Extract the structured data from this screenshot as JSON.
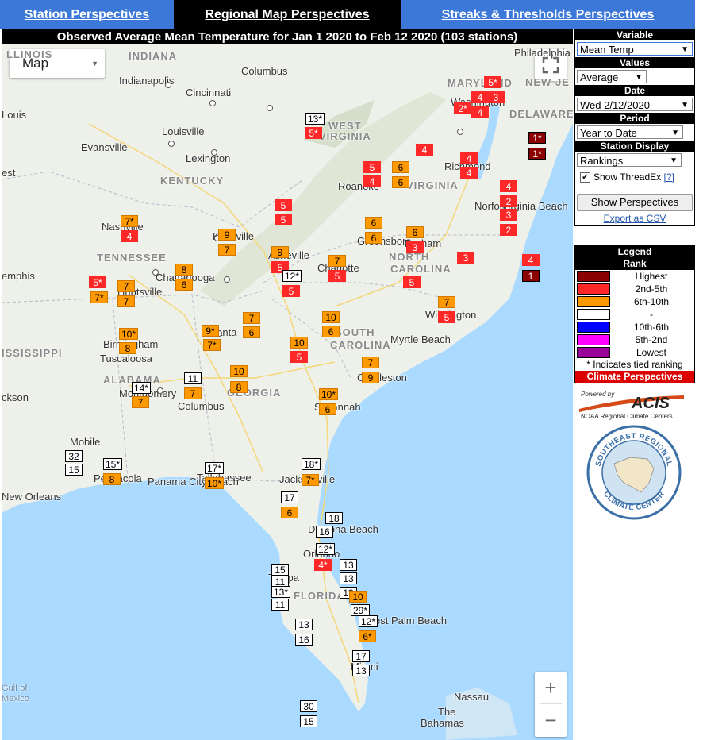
{
  "tabs": [
    "Station Perspectives",
    "Regional Map Perspectives",
    "Streaks & Thresholds Perspectives"
  ],
  "title": "Observed Average Mean Temperature for Jan 1 2020 to Feb 12 2020 (103 stations)",
  "map_type": "Map",
  "zoom": {
    "in": "+",
    "out": "−"
  },
  "controls": {
    "variable_label": "Variable",
    "variable": "Mean Temp",
    "values_label": "Values",
    "values": "Average",
    "date_label": "Date",
    "date": "Wed 2/12/2020",
    "period_label": "Period",
    "period": "Year to Date",
    "display_label": "Station Display",
    "display": "Rankings",
    "threadex_label": "Show ThreadEx",
    "threadex_help": "[?]",
    "threadex_checked": true,
    "show_button": "Show Perspectives",
    "export_link": "Export as CSV"
  },
  "legend": {
    "title": "Legend",
    "subtitle": "Rank",
    "items": [
      {
        "label": "Highest",
        "color": "#8b0000"
      },
      {
        "label": "2nd-5th",
        "color": "#ff2828"
      },
      {
        "label": "6th-10th",
        "color": "#ff9900"
      },
      {
        "label": "-",
        "color": "#ffffff"
      },
      {
        "label": "10th-6th",
        "color": "#0000ff"
      },
      {
        "label": "5th-2nd",
        "color": "#ff00ff"
      },
      {
        "label": "Lowest",
        "color": "#990099"
      }
    ],
    "note": "* Indicates tied ranking",
    "footer": "Climate Perspectives"
  },
  "acis": {
    "powered_by": "Powered by",
    "name": "ACIS",
    "sub": "NOAA Regional Climate Centers"
  },
  "seal": {
    "top": "SOUTHEAST REGIONAL",
    "bottom": "CLIMATE CENTER"
  },
  "map_labels": {
    "states": [
      {
        "text": "INDIANA"
      },
      {
        "text": "KENTUCKY"
      },
      {
        "text": "TENNESSEE"
      },
      {
        "text": "WEST"
      },
      {
        "text": "VIRGINIA"
      },
      {
        "text": "VIRGINIA"
      },
      {
        "text": "NORTH"
      },
      {
        "text": "CAROLINA"
      },
      {
        "text": "SOUTH"
      },
      {
        "text": "CAROLINA"
      },
      {
        "text": "GEORGIA"
      },
      {
        "text": "ALABAMA"
      },
      {
        "text": "ISSISSIPPI"
      },
      {
        "text": "FLORIDA"
      },
      {
        "text": "MARYLAND"
      },
      {
        "text": "DELAWARE"
      },
      {
        "text": "NEW JE"
      },
      {
        "text": "LLINOIS"
      }
    ],
    "cities": [
      "Columbus",
      "Indianapolis",
      "Cincinnati",
      "Louisville",
      "Lexington",
      "Evansville",
      "Louis",
      "est",
      "Nashville",
      "Chattanooga",
      "Knoxville",
      "Asheville",
      "Huntsville",
      "Birmingham",
      "Tuscaloosa",
      "Atlanta",
      "Montgomery",
      "Columbus",
      "Mobile",
      "Pensacola",
      "Tallahassee",
      "Jacksonville",
      "Savannah",
      "Charleston",
      "Myrtle Beach",
      "Wilmington",
      "Charlotte",
      "Greensboro",
      "Durham",
      "Roanoke",
      "Richmond",
      "Washington",
      "Norfolk",
      "Virginia Beach",
      "Philadelphia",
      "Daytona Beach",
      "Orlando",
      "Tampa",
      "West Palm Beach",
      "Miami",
      "Nassau",
      "The",
      "Bahamas",
      "New Orleans",
      "Panama City Beach",
      "Gulf of",
      "Mexico",
      "emphis",
      "ckson"
    ]
  },
  "markers": [
    {
      "v": "5*",
      "r": "top5"
    },
    {
      "v": "4",
      "r": "top5"
    },
    {
      "v": "3",
      "r": "top5"
    },
    {
      "v": "2*",
      "r": "top5"
    },
    {
      "v": "4",
      "r": "top5"
    },
    {
      "v": "13*",
      "r": "none"
    },
    {
      "v": "5*",
      "r": "top5"
    },
    {
      "v": "1*",
      "r": "high"
    },
    {
      "v": "1*",
      "r": "high"
    },
    {
      "v": "4",
      "r": "top5"
    },
    {
      "v": "4",
      "r": "top5"
    },
    {
      "v": "4",
      "r": "top5"
    },
    {
      "v": "5",
      "r": "top5"
    },
    {
      "v": "4",
      "r": "top5"
    },
    {
      "v": "6",
      "r": "top10"
    },
    {
      "v": "6",
      "r": "top10"
    },
    {
      "v": "4",
      "r": "top5"
    },
    {
      "v": "2",
      "r": "top5"
    },
    {
      "v": "3",
      "r": "top5"
    },
    {
      "v": "2",
      "r": "top5"
    },
    {
      "v": "5",
      "r": "top5"
    },
    {
      "v": "5",
      "r": "top5"
    },
    {
      "v": "7*",
      "r": "top10"
    },
    {
      "v": "4",
      "r": "top5"
    },
    {
      "v": "9",
      "r": "top10"
    },
    {
      "v": "7",
      "r": "top10"
    },
    {
      "v": "6",
      "r": "top10"
    },
    {
      "v": "6",
      "r": "top10"
    },
    {
      "v": "6",
      "r": "top10"
    },
    {
      "v": "3",
      "r": "top5"
    },
    {
      "v": "3",
      "r": "top5"
    },
    {
      "v": "4",
      "r": "top5"
    },
    {
      "v": "1",
      "r": "high"
    },
    {
      "v": "8",
      "r": "top10"
    },
    {
      "v": "6",
      "r": "top10"
    },
    {
      "v": "9",
      "r": "top10"
    },
    {
      "v": "5",
      "r": "top5"
    },
    {
      "v": "12*",
      "r": "none"
    },
    {
      "v": "7",
      "r": "top10"
    },
    {
      "v": "5",
      "r": "top5"
    },
    {
      "v": "5",
      "r": "top5"
    },
    {
      "v": "5",
      "r": "top5"
    },
    {
      "v": "5*",
      "r": "top5"
    },
    {
      "v": "7*",
      "r": "top10"
    },
    {
      "v": "7",
      "r": "top10"
    },
    {
      "v": "7",
      "r": "top10"
    },
    {
      "v": "7",
      "r": "top10"
    },
    {
      "v": "6",
      "r": "top10"
    },
    {
      "v": "10*",
      "r": "top10"
    },
    {
      "v": "8",
      "r": "top10"
    },
    {
      "v": "9*",
      "r": "top10"
    },
    {
      "v": "7*",
      "r": "top10"
    },
    {
      "v": "7",
      "r": "top10"
    },
    {
      "v": "5",
      "r": "top5"
    },
    {
      "v": "10",
      "r": "top10"
    },
    {
      "v": "6",
      "r": "top10"
    },
    {
      "v": "10",
      "r": "top10"
    },
    {
      "v": "5",
      "r": "top5"
    },
    {
      "v": "7",
      "r": "top10"
    },
    {
      "v": "9",
      "r": "top10"
    },
    {
      "v": "11",
      "r": "none"
    },
    {
      "v": "7",
      "r": "top10"
    },
    {
      "v": "10",
      "r": "top10"
    },
    {
      "v": "8",
      "r": "top10"
    },
    {
      "v": "14*",
      "r": "none"
    },
    {
      "v": "7",
      "r": "top10"
    },
    {
      "v": "10*",
      "r": "top10"
    },
    {
      "v": "6",
      "r": "top10"
    },
    {
      "v": "32",
      "r": "none"
    },
    {
      "v": "15",
      "r": "none"
    },
    {
      "v": "15*",
      "r": "none"
    },
    {
      "v": "8",
      "r": "top10"
    },
    {
      "v": "17*",
      "r": "none"
    },
    {
      "v": "10*",
      "r": "top10"
    },
    {
      "v": "18*",
      "r": "none"
    },
    {
      "v": "7*",
      "r": "top10"
    },
    {
      "v": "17",
      "r": "none"
    },
    {
      "v": "6",
      "r": "top10"
    },
    {
      "v": "18",
      "r": "none"
    },
    {
      "v": "16",
      "r": "none"
    },
    {
      "v": "12*",
      "r": "none"
    },
    {
      "v": "4*",
      "r": "top5"
    },
    {
      "v": "13",
      "r": "none"
    },
    {
      "v": "13",
      "r": "none"
    },
    {
      "v": "13",
      "r": "none"
    },
    {
      "v": "10",
      "r": "top10"
    },
    {
      "v": "29*",
      "r": "none"
    },
    {
      "v": "15",
      "r": "none"
    },
    {
      "v": "11",
      "r": "none"
    },
    {
      "v": "13*",
      "r": "none"
    },
    {
      "v": "11",
      "r": "none"
    },
    {
      "v": "13",
      "r": "none"
    },
    {
      "v": "16",
      "r": "none"
    },
    {
      "v": "12*",
      "r": "none"
    },
    {
      "v": "6*",
      "r": "top10"
    },
    {
      "v": "17",
      "r": "none"
    },
    {
      "v": "13",
      "r": "none"
    },
    {
      "v": "30",
      "r": "none"
    },
    {
      "v": "15",
      "r": "none"
    }
  ]
}
